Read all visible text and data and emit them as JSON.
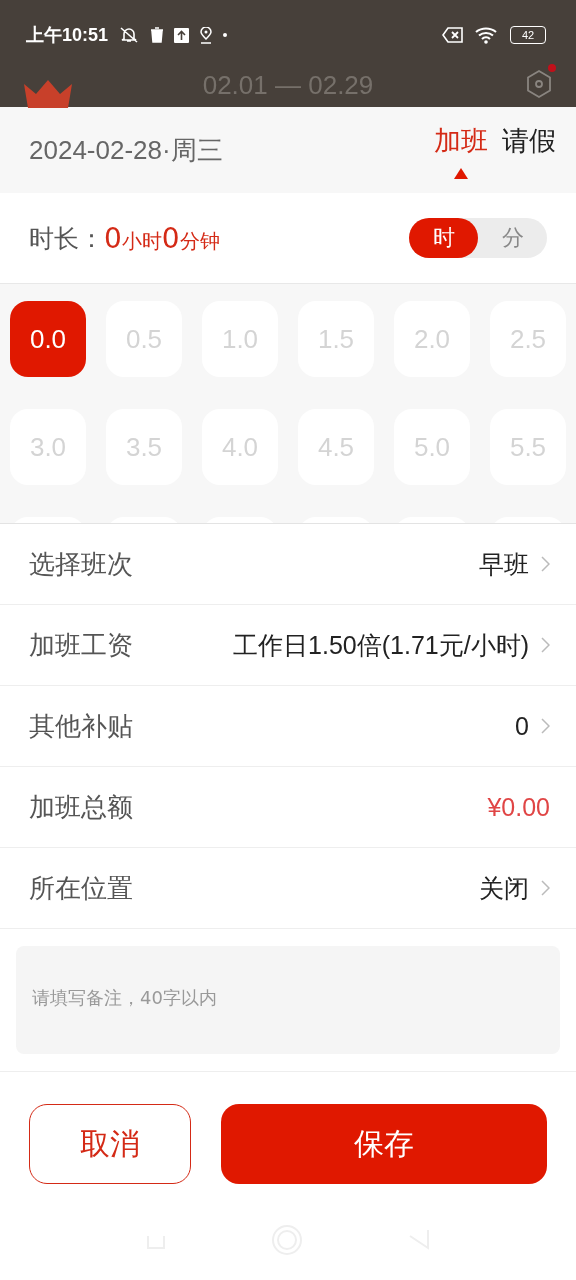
{
  "status_bar": {
    "time": "上午10:51",
    "battery": "42"
  },
  "header": {
    "title": "02.01 — 02.29"
  },
  "date": "2024-02-28·周三",
  "tabs": [
    {
      "label": "加班",
      "selected": true
    },
    {
      "label": "请假",
      "selected": false
    }
  ],
  "duration": {
    "label": "时长：",
    "hours": "0",
    "hours_unit": "小时",
    "minutes": "0",
    "minutes_unit": "分钟"
  },
  "units": [
    {
      "label": "时",
      "selected": true
    },
    {
      "label": "分",
      "selected": false
    }
  ],
  "hour_options": [
    {
      "label": "0.0",
      "selected": true
    },
    {
      "label": "0.5",
      "selected": false
    },
    {
      "label": "1.0",
      "selected": false
    },
    {
      "label": "1.5",
      "selected": false
    },
    {
      "label": "2.0",
      "selected": false
    },
    {
      "label": "2.5",
      "selected": false
    },
    {
      "label": "3.0",
      "selected": false
    },
    {
      "label": "3.5",
      "selected": false
    },
    {
      "label": "4.0",
      "selected": false
    },
    {
      "label": "4.5",
      "selected": false
    },
    {
      "label": "5.0",
      "selected": false
    },
    {
      "label": "5.5",
      "selected": false
    }
  ],
  "rows": [
    {
      "kind": "link",
      "label": "选择班次",
      "value": "早班"
    },
    {
      "kind": "link",
      "label": "加班工资",
      "value": "工作日1.50倍(1.71元/小时)"
    },
    {
      "kind": "link",
      "label": "其他补贴",
      "value": "0"
    },
    {
      "kind": "amount",
      "label": "加班总额",
      "value": "¥0.00"
    },
    {
      "kind": "link",
      "label": "所在位置",
      "value": "关闭"
    }
  ],
  "note": {
    "placeholder": "请填写备注，40字以内"
  },
  "buttons": {
    "cancel": "取消",
    "save": "保存"
  }
}
